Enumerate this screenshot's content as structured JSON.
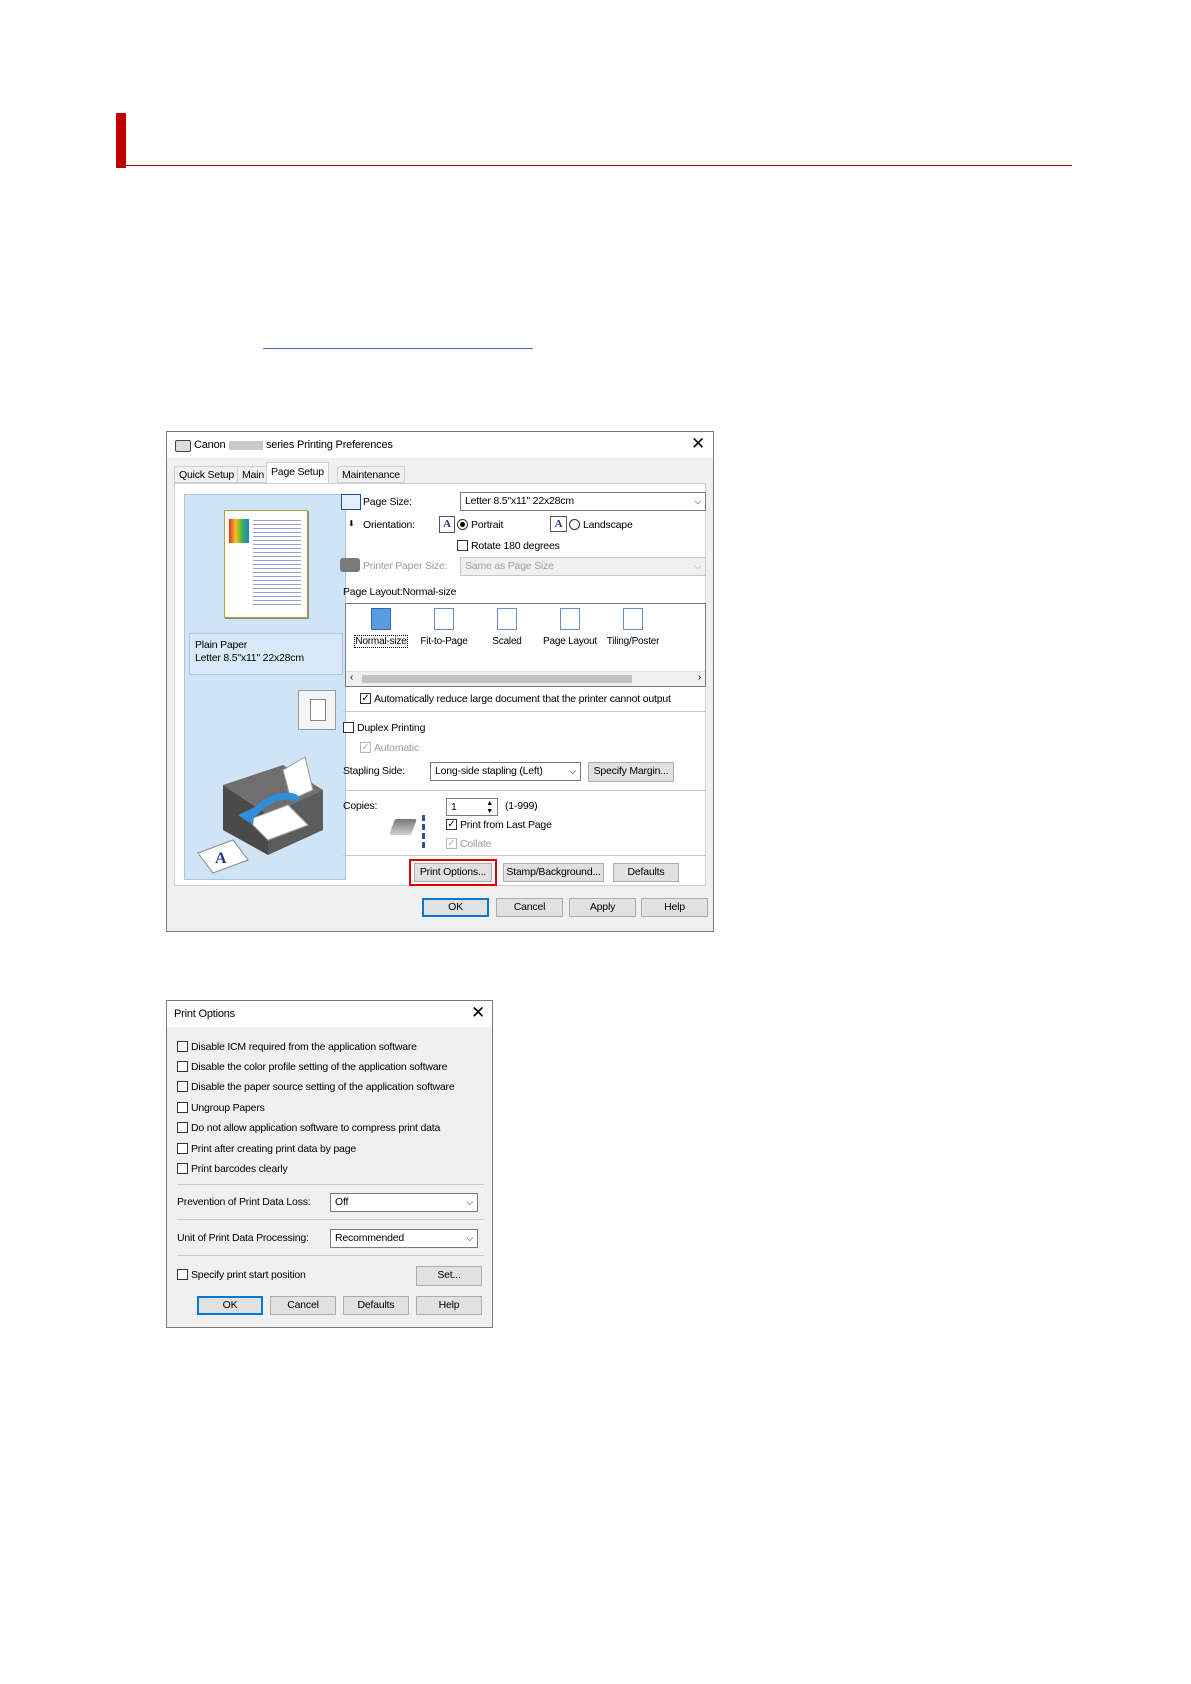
{
  "dialog1": {
    "title_prefix": "Canon",
    "title_suffix": "series Printing Preferences",
    "close": "✕",
    "tabs": [
      "Quick Setup",
      "Main",
      "Page Setup",
      "Maintenance"
    ],
    "preview": {
      "paper_name": "Plain Paper",
      "paper_size": "Letter 8.5\"x11\" 22x28cm"
    },
    "page_size": {
      "label": "Page Size:",
      "value": "Letter 8.5\"x11\" 22x28cm"
    },
    "orientation": {
      "label": "Orientation:",
      "portrait": "Portrait",
      "landscape": "Landscape",
      "rotate": "Rotate 180 degrees"
    },
    "printer_paper_size": {
      "label": "Printer Paper Size:",
      "value": "Same as Page Size"
    },
    "page_layout": {
      "label": "Page Layout:Normal-size",
      "items": [
        "Normal-size",
        "Fit-to-Page",
        "Scaled",
        "Page Layout",
        "Tiling/Poster"
      ],
      "auto_reduce": "Automatically reduce large document that the printer cannot output"
    },
    "duplex": {
      "label": "Duplex Printing",
      "automatic": "Automatic"
    },
    "stapling": {
      "label": "Stapling Side:",
      "value": "Long-side stapling (Left)",
      "margin_button": "Specify Margin..."
    },
    "copies": {
      "label": "Copies:",
      "value": "1",
      "range": "(1-999)",
      "last_page": "Print from Last Page",
      "collate": "Collate"
    },
    "buttons": {
      "print_options": "Print Options...",
      "stamp": "Stamp/Background...",
      "defaults": "Defaults",
      "ok": "OK",
      "cancel": "Cancel",
      "apply": "Apply",
      "help": "Help"
    }
  },
  "dialog2": {
    "title": "Print Options",
    "close": "✕",
    "checkboxes": [
      "Disable ICM required from the application software",
      "Disable the color profile setting of the application software",
      "Disable the paper source setting of the application software",
      "Ungroup Papers",
      "Do not allow application software to compress print data",
      "Print after creating print data by page",
      "Print barcodes clearly"
    ],
    "prevention": {
      "label": "Prevention of Print Data Loss:",
      "value": "Off"
    },
    "unit": {
      "label": "Unit of Print Data Processing:",
      "value": "Recommended"
    },
    "start_position": {
      "label": "Specify print start position",
      "set_button": "Set..."
    },
    "buttons": {
      "ok": "OK",
      "cancel": "Cancel",
      "defaults": "Defaults",
      "help": "Help"
    }
  },
  "colors": {
    "accent_red": "#c00000",
    "highlight": "#e00000",
    "preview_bg": "#cfe4f6"
  }
}
